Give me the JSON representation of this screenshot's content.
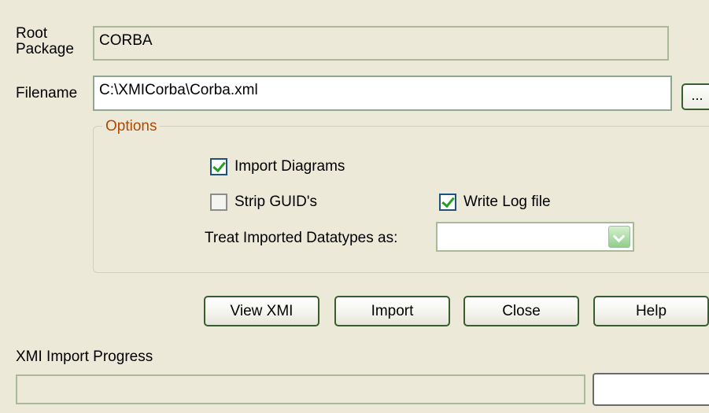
{
  "root_package": {
    "label": "Root Package",
    "value": "CORBA"
  },
  "filename": {
    "label": "Filename",
    "value": "C:\\XMICorba\\Corba.xml",
    "browse_label": "..."
  },
  "options": {
    "legend": "Options",
    "import_diagrams": {
      "label": "Import Diagrams",
      "checked": true
    },
    "strip_guids": {
      "label": "Strip GUID's",
      "checked": false
    },
    "write_log": {
      "label": "Write Log file",
      "checked": true
    },
    "datatypes": {
      "label": "Treat Imported Datatypes as:",
      "value": ""
    }
  },
  "buttons": {
    "view_xmi": "View XMI",
    "import": "Import",
    "close": "Close",
    "help": "Help"
  },
  "progress": {
    "label": "XMI Import Progress",
    "value": 0,
    "fill_color": "#5fbf5f"
  },
  "icons": {
    "checkbox_checked": "check-icon",
    "combo_arrow": "chevron-down-icon"
  }
}
